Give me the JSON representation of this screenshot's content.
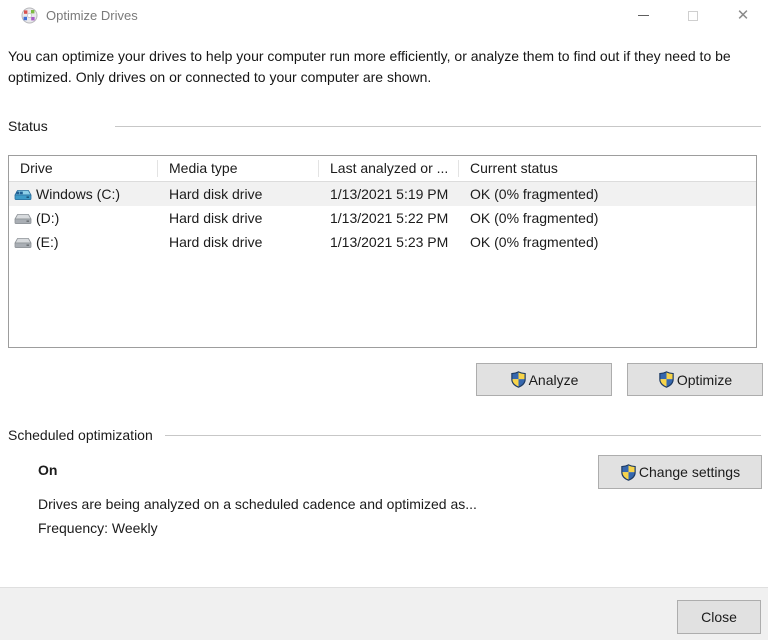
{
  "window": {
    "title": "Optimize Drives",
    "controls": {
      "close_glyph": "✕"
    }
  },
  "description": "You can optimize your drives to help your computer run more efficiently, or analyze them to find out if they need to be optimized. Only drives on or connected to your computer are shown.",
  "status_section": {
    "label": "Status",
    "table": {
      "columns": [
        "Drive",
        "Media type",
        "Last analyzed or ...",
        "Current status"
      ],
      "rows": [
        {
          "icon": "windows-drive-icon",
          "drive": "Windows (C:)",
          "media_type": "Hard disk drive",
          "last_analyzed": "1/13/2021 5:19 PM",
          "current_status": "OK (0% fragmented)",
          "selected": true
        },
        {
          "icon": "drive-icon",
          "drive": "(D:)",
          "media_type": "Hard disk drive",
          "last_analyzed": "1/13/2021 5:22 PM",
          "current_status": "OK (0% fragmented)",
          "selected": false
        },
        {
          "icon": "drive-icon",
          "drive": "(E:)",
          "media_type": "Hard disk drive",
          "last_analyzed": "1/13/2021 5:23 PM",
          "current_status": "OK (0% fragmented)",
          "selected": false
        }
      ]
    },
    "analyze_label": "Analyze",
    "optimize_label": "Optimize"
  },
  "scheduled_section": {
    "label": "Scheduled optimization",
    "state": "On",
    "description": "Drives are being analyzed on a scheduled cadence and optimized as...",
    "frequency": "Frequency: Weekly",
    "change_settings_label": "Change settings"
  },
  "footer": {
    "close_label": "Close"
  },
  "colors": {
    "shield_blue": "#3567ae",
    "shield_yellow": "#f7d44a",
    "button_bg": "#e1e1e1",
    "button_border": "#adadad",
    "footer_bg": "#f0f0f0",
    "selected_row_bg": "#f1f1f1"
  }
}
